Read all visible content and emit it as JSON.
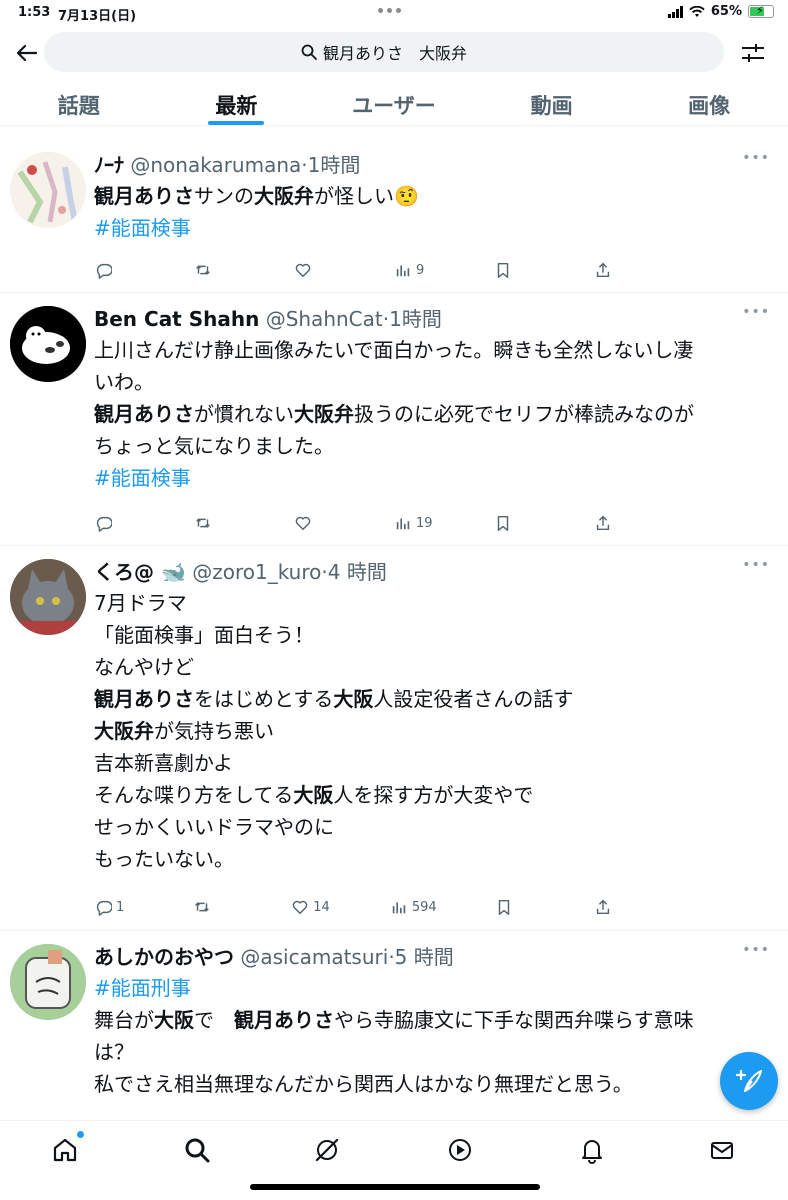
{
  "status_bar": {
    "time": "1:53",
    "date": "7月13日(日)",
    "battery": "65%",
    "battery_level": 0.65
  },
  "header": {
    "search_query": "観月ありさ　大阪弁"
  },
  "tabs": [
    {
      "label": "話題",
      "active": false
    },
    {
      "label": "最新",
      "active": true
    },
    {
      "label": "ユーザー",
      "active": false
    },
    {
      "label": "動画",
      "active": false
    },
    {
      "label": "画像",
      "active": false
    }
  ],
  "tweets": [
    {
      "name": "ﾉｰﾅ",
      "handle": "@nonakarumana",
      "time": "1時間",
      "lines": [
        [
          {
            "t": "観月ありさ",
            "b": true
          },
          {
            "t": "サンの"
          },
          {
            "t": "大阪弁",
            "b": true
          },
          {
            "t": "が怪しい🤨"
          }
        ],
        [
          {
            "t": "#能面検事",
            "h": true
          }
        ]
      ],
      "stats": {
        "replies": "",
        "retweets": "",
        "likes": "",
        "views": "9"
      }
    },
    {
      "name": "Ben Cat Shahn",
      "handle": "@ShahnCat",
      "time": "1時間",
      "lines": [
        [
          {
            "t": "上川さんだけ静止画像みたいで面白かった。瞬きも全然しないし凄"
          }
        ],
        [
          {
            "t": "いわ。"
          }
        ],
        [
          {
            "t": "観月ありさ",
            "b": true
          },
          {
            "t": "が慣れない"
          },
          {
            "t": "大阪弁",
            "b": true
          },
          {
            "t": "扱うのに必死でセリフが棒読みなのが"
          }
        ],
        [
          {
            "t": "ちょっと気になりました。"
          }
        ],
        [
          {
            "t": " #能面検事",
            "h": true
          }
        ]
      ],
      "stats": {
        "replies": "",
        "retweets": "",
        "likes": "",
        "views": "19"
      }
    },
    {
      "name": "くろ@ 🐋",
      "handle": "@zoro1_kuro",
      "time": "4 時間",
      "lines": [
        [
          {
            "t": "7月ドラマ"
          }
        ],
        [
          {
            "t": "「能面検事」面白そう！"
          }
        ],
        [
          {
            "t": "なんやけど"
          }
        ],
        [
          {
            "t": "観月ありさ",
            "b": true
          },
          {
            "t": "をはじめとする"
          },
          {
            "t": "大阪",
            "b": true
          },
          {
            "t": "人設定役者さんの話す"
          }
        ],
        [
          {
            "t": "大阪弁",
            "b": true
          },
          {
            "t": "が気持ち悪い"
          }
        ],
        [
          {
            "t": "吉本新喜劇かよ"
          }
        ],
        [
          {
            "t": "そんな喋り方をしてる"
          },
          {
            "t": "大阪",
            "b": true
          },
          {
            "t": "人を探す方が大変やで"
          }
        ],
        [
          {
            "t": "せっかくいいドラマやのに"
          }
        ],
        [
          {
            "t": "もったいない。"
          }
        ]
      ],
      "stats": {
        "replies": "1",
        "retweets": "",
        "likes": "14",
        "views": "594"
      }
    },
    {
      "name": "あしかのおやつ",
      "handle": "@asicamatsuri",
      "time": "5 時間",
      "lines": [
        [
          {
            "t": " #能面刑事",
            "h": true
          }
        ],
        [
          {
            "t": "舞台が"
          },
          {
            "t": "大阪",
            "b": true
          },
          {
            "t": "で　"
          },
          {
            "t": "観月ありさ",
            "b": true
          },
          {
            "t": "やら寺脇康文に下手な関西弁喋らす意味"
          }
        ],
        [
          {
            "t": "は？"
          }
        ],
        [
          {
            "t": "私でさえ相当無理なんだから関西人はかなり無理だと思う。"
          }
        ]
      ],
      "stats": {
        "replies": "",
        "retweets": "",
        "likes": "",
        "views": ""
      }
    }
  ],
  "icons": {
    "back": "arrow-left-icon",
    "search": "search-icon",
    "filter": "sliders-icon",
    "reply": "reply-icon",
    "retweet": "retweet-icon",
    "like": "heart-icon",
    "views": "views-icon",
    "bookmark": "bookmark-icon",
    "share": "share-icon",
    "compose": "compose-icon",
    "home": "home-icon",
    "explore": "search-icon",
    "grok": "grok-icon",
    "video": "play-icon",
    "notifications": "bell-icon",
    "messages": "mail-icon"
  },
  "colors": {
    "accent": "#1d9bf0",
    "text": "#0f1419",
    "secondary": "#536471"
  }
}
